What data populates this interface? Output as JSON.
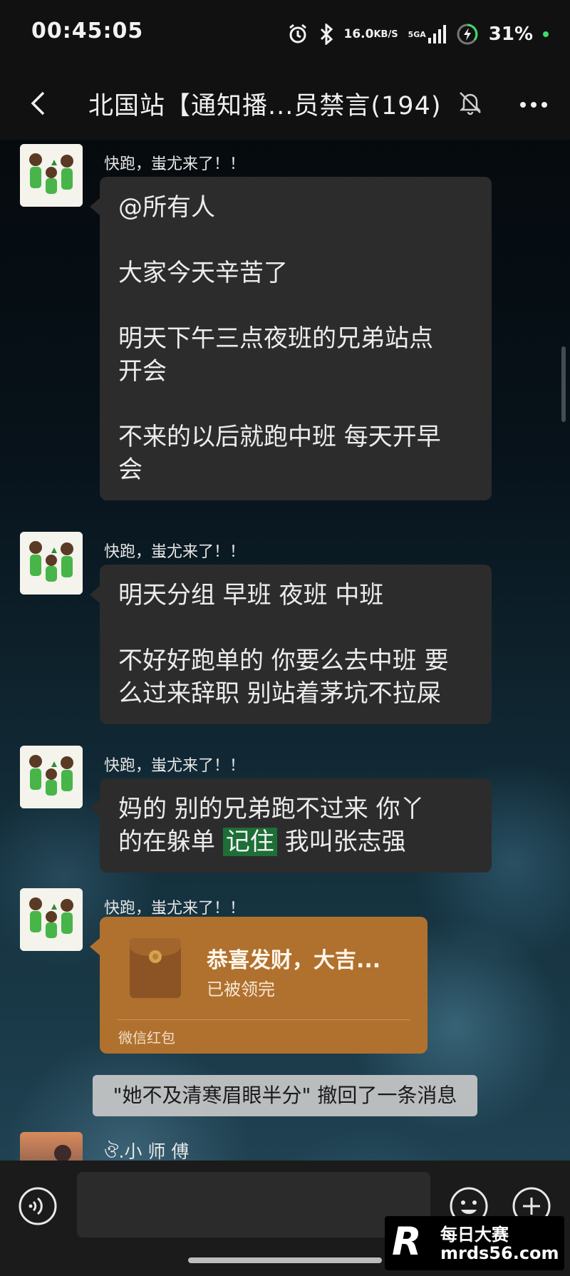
{
  "status_bar": {
    "time": "00:45:05",
    "net_speed_value": "16.0",
    "net_speed_unit": "KB/S",
    "signal_label": "5GA",
    "battery_percent": "31%"
  },
  "header": {
    "title": "北国站【通知播...员禁言(194)"
  },
  "messages": [
    {
      "sender": "快跑，蚩尤来了！！",
      "lines": [
        "@所有人",
        "大家今天辛苦了",
        "明天下午三点夜班的兄弟站点",
        "开会",
        "不来的以后就跑中班 每天开早",
        "会"
      ]
    },
    {
      "sender": "快跑，蚩尤来了！！",
      "lines": [
        "明天分组 早班 夜班 中班",
        "不好好跑单的 你要么去中班 要",
        "么过来辞职 别站着茅坑不拉屎"
      ]
    },
    {
      "sender": "快跑，蚩尤来了！！",
      "line1": "妈的 别的兄弟跑不过来  你丫",
      "line2_pre": "的在躲单 ",
      "line2_highlight": "记住",
      "line2_post": " 我叫张志强"
    },
    {
      "sender": "快跑，蚩尤来了！！",
      "red_packet": {
        "title": "恭喜发财，大吉...",
        "status": "已被领完",
        "footer": "微信红包"
      }
    }
  ],
  "system_notice": "\"她不及清寒眉眼半分\" 撤回了一条消息",
  "last_sender": "ঔ.小 师 傅",
  "input": {
    "value": ""
  },
  "watermark": {
    "logo": "R",
    "name": "每日大赛",
    "url": "mrds56.com"
  }
}
